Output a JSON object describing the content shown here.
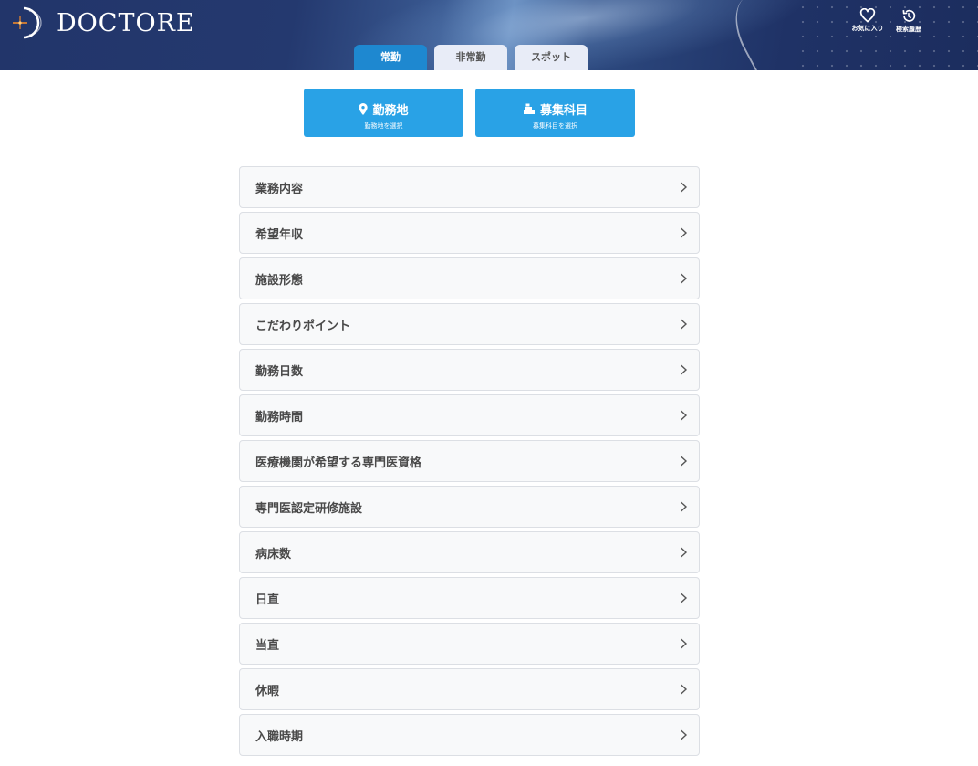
{
  "header": {
    "logo_text": "DOCTORE",
    "favorites_label": "お気に入り",
    "history_label": "検索履歴"
  },
  "tabs": [
    {
      "label": "常勤",
      "active": true
    },
    {
      "label": "非常勤",
      "active": false
    },
    {
      "label": "スポット",
      "active": false
    }
  ],
  "selectors": {
    "area": {
      "label": "勤務地",
      "sub": "勤務地を選択",
      "icon": "map-pin-icon"
    },
    "department": {
      "label": "募集科目",
      "sub": "募集科目を選択",
      "icon": "department-icon"
    }
  },
  "filters": [
    {
      "label": "業務内容"
    },
    {
      "label": "希望年収"
    },
    {
      "label": "施設形態"
    },
    {
      "label": "こだわりポイント"
    },
    {
      "label": "勤務日数"
    },
    {
      "label": "勤務時間"
    },
    {
      "label": "医療機関が希望する専門医資格"
    },
    {
      "label": "専門医認定研修施設"
    },
    {
      "label": "病床数"
    },
    {
      "label": "日直"
    },
    {
      "label": "当直"
    },
    {
      "label": "休暇"
    },
    {
      "label": "入職時期"
    }
  ],
  "colors": {
    "accent": "#29a2e6",
    "tab_active": "#1e88d0",
    "tab_inactive": "#e8ecf7",
    "header_bg": "#22356a"
  }
}
